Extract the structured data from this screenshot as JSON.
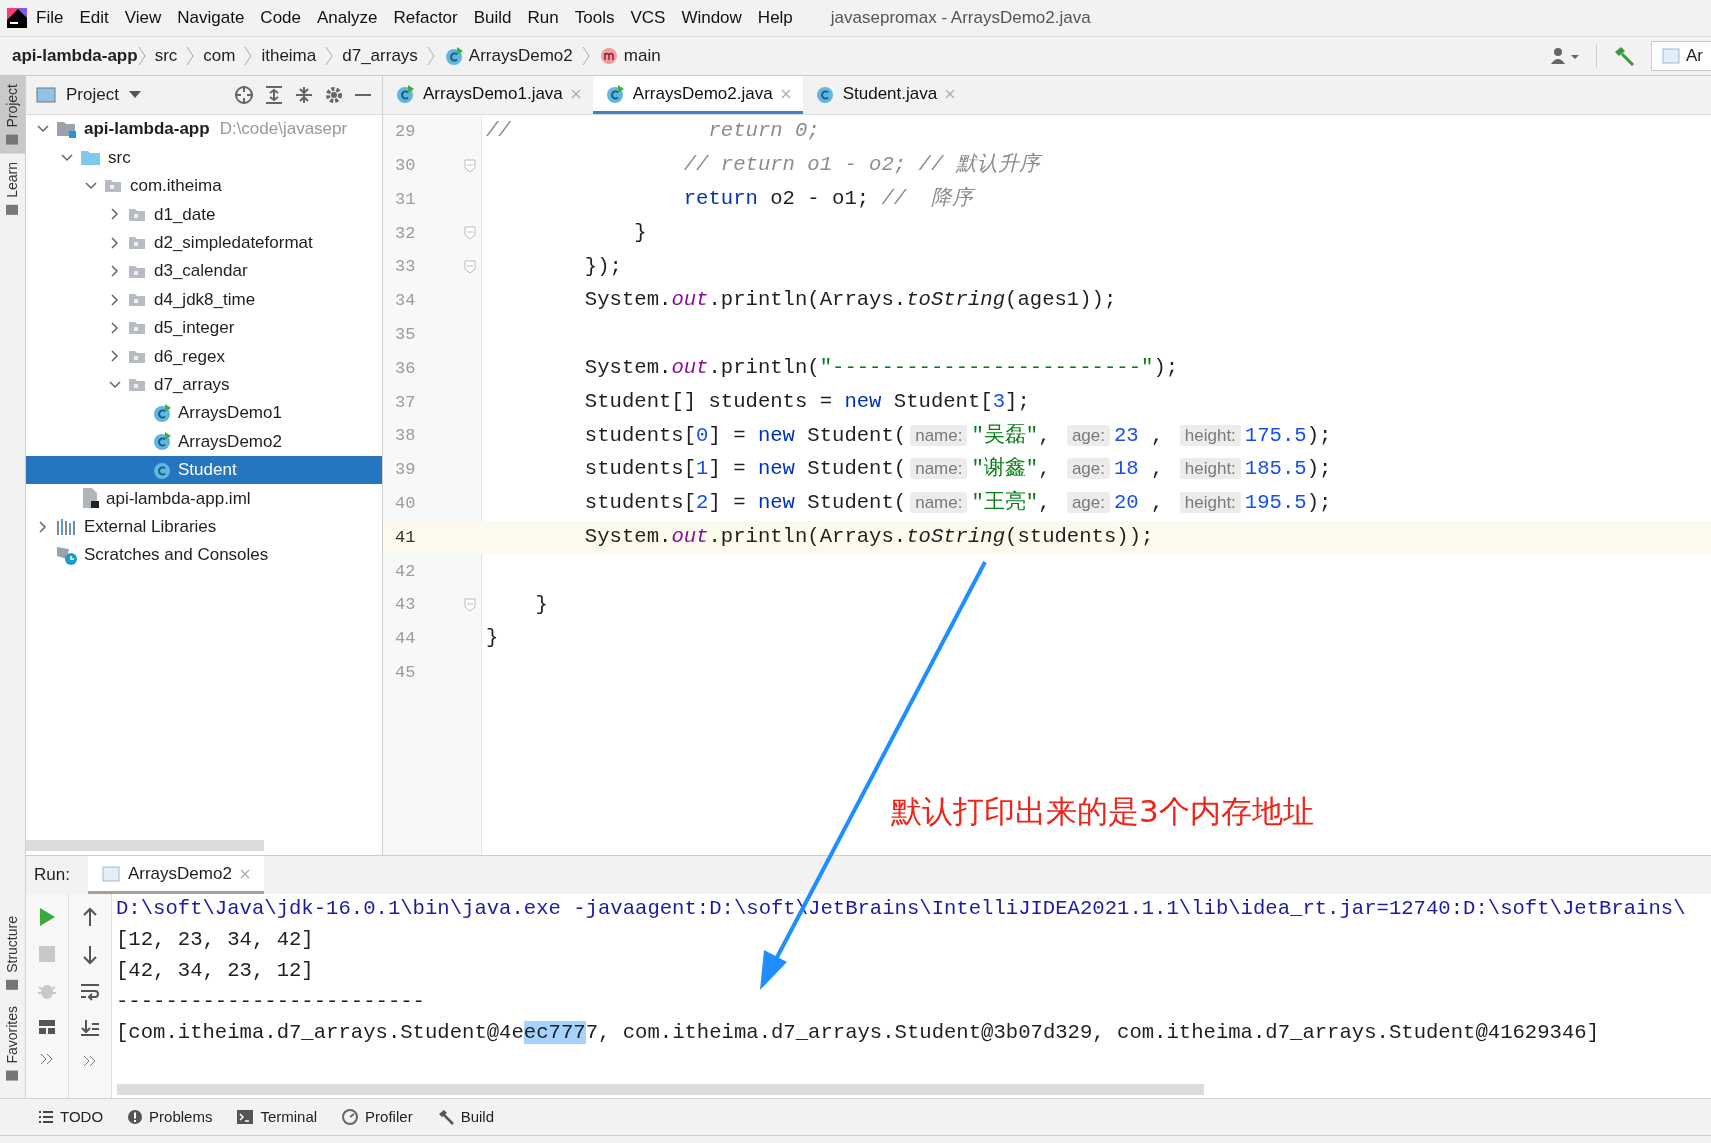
{
  "window": {
    "title": "javasepromax - ArraysDemo2.java"
  },
  "menu": [
    "File",
    "Edit",
    "View",
    "Navigate",
    "Code",
    "Analyze",
    "Refactor",
    "Build",
    "Run",
    "Tools",
    "VCS",
    "Window",
    "Help"
  ],
  "breadcrumbs": [
    {
      "label": "api-lambda-app",
      "kind": "root"
    },
    {
      "label": "src",
      "kind": "folder"
    },
    {
      "label": "com",
      "kind": "folder"
    },
    {
      "label": "itheima",
      "kind": "folder"
    },
    {
      "label": "d7_arrays",
      "kind": "folder"
    },
    {
      "label": "ArraysDemo2",
      "kind": "class"
    },
    {
      "label": "main",
      "kind": "method"
    }
  ],
  "run_config": {
    "value": "Ar"
  },
  "side_strip": {
    "top": [
      {
        "label": "Project",
        "selected": true
      },
      {
        "label": "Learn",
        "selected": false
      }
    ],
    "bottom": [
      {
        "label": "Structure",
        "selected": false
      },
      {
        "label": "Favorites",
        "selected": false
      }
    ]
  },
  "project_panel": {
    "title": "Project",
    "tree": [
      {
        "label": "api-lambda-app",
        "kind": "module",
        "path": "D:\\code\\javasepr",
        "expanded": true,
        "selected": false,
        "children": [
          {
            "label": "src",
            "kind": "source-folder",
            "expanded": true,
            "selected": false,
            "children": [
              {
                "label": "com.itheima",
                "kind": "package",
                "expanded": true,
                "selected": false,
                "children": [
                  {
                    "label": "d1_date",
                    "kind": "package",
                    "expanded": false,
                    "selected": false
                  },
                  {
                    "label": "d2_simpledateformat",
                    "kind": "package",
                    "expanded": false,
                    "selected": false
                  },
                  {
                    "label": "d3_calendar",
                    "kind": "package",
                    "expanded": false,
                    "selected": false
                  },
                  {
                    "label": "d4_jdk8_time",
                    "kind": "package",
                    "expanded": false,
                    "selected": false
                  },
                  {
                    "label": "d5_integer",
                    "kind": "package",
                    "expanded": false,
                    "selected": false
                  },
                  {
                    "label": "d6_regex",
                    "kind": "package",
                    "expanded": false,
                    "selected": false
                  },
                  {
                    "label": "d7_arrays",
                    "kind": "package",
                    "expanded": true,
                    "selected": false,
                    "children": [
                      {
                        "label": "ArraysDemo1",
                        "kind": "runnable-class",
                        "selected": false
                      },
                      {
                        "label": "ArraysDemo2",
                        "kind": "runnable-class",
                        "selected": false
                      },
                      {
                        "label": "Student",
                        "kind": "class",
                        "selected": true
                      }
                    ]
                  }
                ]
              }
            ]
          },
          {
            "label": "api-lambda-app.iml",
            "kind": "iml",
            "selected": false
          }
        ]
      },
      {
        "label": "External Libraries",
        "kind": "libraries",
        "expanded": false,
        "selected": false
      },
      {
        "label": "Scratches and Consoles",
        "kind": "scratches",
        "selected": false
      }
    ]
  },
  "editor_tabs": [
    {
      "label": "ArraysDemo1.java",
      "kind": "runnable-class",
      "selected": false
    },
    {
      "label": "ArraysDemo2.java",
      "kind": "runnable-class",
      "selected": true
    },
    {
      "label": "Student.java",
      "kind": "class",
      "selected": false
    }
  ],
  "code_lines": [
    {
      "number": "29",
      "fold_marker": false,
      "current": false,
      "tokens": [
        {
          "kind": "comment",
          "text": "//                return 0;"
        }
      ]
    },
    {
      "number": "30",
      "fold_marker": true,
      "current": false,
      "tokens": [
        {
          "kind": "comment",
          "text": "                // return o1 - o2; // 默认升序"
        }
      ]
    },
    {
      "number": "31",
      "fold_marker": false,
      "current": false,
      "tokens": [
        {
          "kind": "keyword",
          "text": "                return"
        },
        {
          "kind": "plain",
          "text": " o2 - o1; "
        },
        {
          "kind": "comment",
          "text": "//  降序"
        }
      ]
    },
    {
      "number": "32",
      "fold_marker": true,
      "current": false,
      "tokens": [
        {
          "kind": "plain",
          "text": "            }"
        }
      ]
    },
    {
      "number": "33",
      "fold_marker": true,
      "current": false,
      "tokens": [
        {
          "kind": "plain",
          "text": "        });"
        }
      ]
    },
    {
      "number": "34",
      "fold_marker": false,
      "current": false,
      "tokens": [
        {
          "kind": "plain",
          "text": "        System."
        },
        {
          "kind": "field",
          "text": "out"
        },
        {
          "kind": "plain",
          "text": ".println(Arrays."
        },
        {
          "kind": "method",
          "text": "toString"
        },
        {
          "kind": "plain",
          "text": "(ages1));"
        }
      ]
    },
    {
      "number": "35",
      "fold_marker": false,
      "current": false
    },
    {
      "number": "36",
      "fold_marker": false,
      "current": false,
      "tokens": [
        {
          "kind": "plain",
          "text": "        System."
        },
        {
          "kind": "field",
          "text": "out"
        },
        {
          "kind": "plain",
          "text": ".println("
        },
        {
          "kind": "string",
          "text": "\"-------------------------\""
        },
        {
          "kind": "plain",
          "text": ");"
        }
      ]
    },
    {
      "number": "37",
      "fold_marker": false,
      "current": false,
      "tokens": [
        {
          "kind": "plain",
          "text": "        Student[] students = "
        },
        {
          "kind": "keyword",
          "text": "new"
        },
        {
          "kind": "plain",
          "text": " Student["
        },
        {
          "kind": "number",
          "text": "3"
        },
        {
          "kind": "plain",
          "text": "];"
        }
      ]
    },
    {
      "number": "38",
      "fold_marker": false,
      "current": false,
      "tokens": [
        {
          "kind": "plain",
          "text": "        students["
        },
        {
          "kind": "number",
          "text": "0"
        },
        {
          "kind": "plain",
          "text": "] = "
        },
        {
          "kind": "keyword",
          "text": "new"
        },
        {
          "kind": "plain",
          "text": " Student("
        },
        {
          "kind": "hint",
          "text": "name:"
        },
        {
          "kind": "string",
          "text": "\"吴磊\""
        },
        {
          "kind": "plain",
          "text": ", "
        },
        {
          "kind": "hint",
          "text": "age:"
        },
        {
          "kind": "number",
          "text": "23"
        },
        {
          "kind": "plain",
          "text": " , "
        },
        {
          "kind": "hint",
          "text": "height:"
        },
        {
          "kind": "number",
          "text": "175.5"
        },
        {
          "kind": "plain",
          "text": ");"
        }
      ]
    },
    {
      "number": "39",
      "fold_marker": false,
      "current": false,
      "tokens": [
        {
          "kind": "plain",
          "text": "        students["
        },
        {
          "kind": "number",
          "text": "1"
        },
        {
          "kind": "plain",
          "text": "] = "
        },
        {
          "kind": "keyword",
          "text": "new"
        },
        {
          "kind": "plain",
          "text": " Student("
        },
        {
          "kind": "hint",
          "text": "name:"
        },
        {
          "kind": "string",
          "text": "\"谢鑫\""
        },
        {
          "kind": "plain",
          "text": ", "
        },
        {
          "kind": "hint",
          "text": "age:"
        },
        {
          "kind": "number",
          "text": "18"
        },
        {
          "kind": "plain",
          "text": " , "
        },
        {
          "kind": "hint",
          "text": "height:"
        },
        {
          "kind": "number",
          "text": "185.5"
        },
        {
          "kind": "plain",
          "text": ");"
        }
      ]
    },
    {
      "number": "40",
      "fold_marker": false,
      "current": false,
      "tokens": [
        {
          "kind": "plain",
          "text": "        students["
        },
        {
          "kind": "number",
          "text": "2"
        },
        {
          "kind": "plain",
          "text": "] = "
        },
        {
          "kind": "keyword",
          "text": "new"
        },
        {
          "kind": "plain",
          "text": " Student("
        },
        {
          "kind": "hint",
          "text": "name:"
        },
        {
          "kind": "string",
          "text": "\"王亮\""
        },
        {
          "kind": "plain",
          "text": ", "
        },
        {
          "kind": "hint",
          "text": "age:"
        },
        {
          "kind": "number",
          "text": "20"
        },
        {
          "kind": "plain",
          "text": " , "
        },
        {
          "kind": "hint",
          "text": "height:"
        },
        {
          "kind": "number",
          "text": "195.5"
        },
        {
          "kind": "plain",
          "text": ");"
        }
      ]
    },
    {
      "number": "41",
      "fold_marker": false,
      "current": true,
      "tokens": [
        {
          "kind": "plain",
          "text": "        System."
        },
        {
          "kind": "field",
          "text": "out"
        },
        {
          "kind": "plain",
          "text": ".println(Arrays."
        },
        {
          "kind": "method",
          "text": "toString"
        },
        {
          "kind": "plain",
          "text": "(students));"
        }
      ]
    },
    {
      "number": "42",
      "fold_marker": false,
      "current": false
    },
    {
      "number": "43",
      "fold_marker": true,
      "current": false,
      "tokens": [
        {
          "kind": "plain",
          "text": "    }"
        }
      ]
    },
    {
      "number": "44",
      "fold_marker": false,
      "current": false,
      "tokens": [
        {
          "kind": "plain",
          "text": "}"
        }
      ]
    },
    {
      "number": "45",
      "fold_marker": false,
      "current": false
    }
  ],
  "annotation": "默认打印出来的是3个内存地址",
  "run_panel": {
    "label": "Run:",
    "tab": "ArraysDemo2",
    "console": [
      {
        "kind": "command",
        "segments": [
          {
            "text": "D:\\soft\\Java\\jdk-16.0.1\\bin\\java.exe -javaagent:D:\\soft\\JetBrains\\IntelliJIDEA2021.1.1\\lib\\idea_rt.jar=12740:D:\\soft\\JetBrains\\",
            "selected": false
          }
        ]
      },
      {
        "kind": "output",
        "segments": [
          {
            "text": "[12, 23, 34, 42]",
            "selected": false
          }
        ]
      },
      {
        "kind": "output",
        "segments": [
          {
            "text": "[42, 34, 23, 12]",
            "selected": false
          }
        ]
      },
      {
        "kind": "output",
        "segments": [
          {
            "text": "-------------------------",
            "selected": false
          }
        ]
      },
      {
        "kind": "output",
        "segments": [
          {
            "text": "[com.itheima.d7_arrays.Student@4e",
            "selected": false
          },
          {
            "text": "ec777",
            "selected": true
          },
          {
            "text": "7, com.itheima.d7_arrays.Student@3b07d329, com.itheima.d7_arrays.Student@41629346]",
            "selected": false
          }
        ]
      }
    ]
  },
  "bottom_tools": [
    {
      "label": "TODO",
      "kind": "list"
    },
    {
      "label": "Problems",
      "kind": "problems"
    },
    {
      "label": "Terminal",
      "kind": "terminal"
    },
    {
      "label": "Profiler",
      "kind": "profiler"
    },
    {
      "label": "Build",
      "kind": "build"
    }
  ]
}
